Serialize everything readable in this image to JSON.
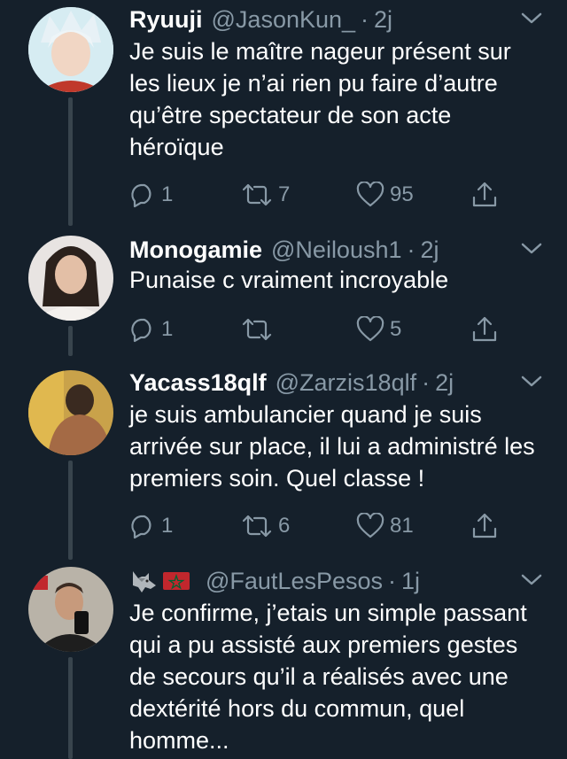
{
  "tweets": [
    {
      "name": "Ryuuji",
      "handle": "@JasonKun_",
      "time": "2j",
      "text": "Je suis le maître nageur présent sur les lieux je n’ai rien pu faire d’autre qu’être spectateur de son acte héroïque",
      "replies": "1",
      "retweets": "7",
      "likes": "95"
    },
    {
      "name": "Monogamie",
      "handle": "@Neiloush1",
      "time": "2j",
      "text": "Punaise c vraiment incroyable",
      "replies": "1",
      "retweets": "",
      "likes": "5"
    },
    {
      "name": "Yacass18qlf",
      "handle": "@Zarzis18qlf",
      "time": "2j",
      "text": "je suis ambulancier quand je suis arrivée sur place, il lui a administré les premiers soin. Quel classe !",
      "replies": "1",
      "retweets": "6",
      "likes": "81"
    },
    {
      "name": "",
      "name_icons": [
        "wolf-emoji",
        "morocco-flag-emoji"
      ],
      "handle": "@FautLesPesos",
      "time": "1j",
      "text": "Je confirme, j’etais un simple passant qui a pu assisté aux premiers gestes de secours qu’il a réalisés avec une dextérité hors du commun, quel homme...",
      "replies": "",
      "retweets": "",
      "likes": ""
    }
  ],
  "colors": {
    "background": "#15202b",
    "secondary_text": "#8899a6",
    "thread_line": "#38444d"
  },
  "icons": {
    "reply": "speech-bubble-icon",
    "retweet": "retweet-arrows-icon",
    "like": "heart-outline-icon",
    "share": "share-upload-icon",
    "menu": "chevron-down-icon"
  }
}
